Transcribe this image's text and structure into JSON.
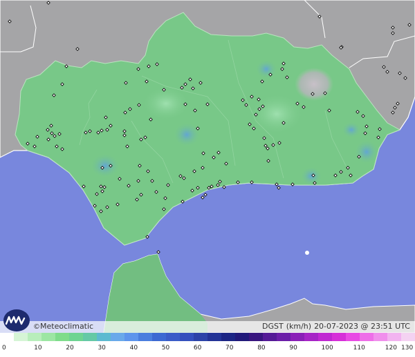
{
  "map": {
    "sea_color": "#7887dd",
    "land_outside_color": "#a5a5a7",
    "region_color": "#78c888",
    "marker_glyph": "⋄"
  },
  "brand": {
    "copyright_symbol": "©",
    "name": "Meteoclimatic",
    "logo_icon": "meteoclimatic-wave-logo"
  },
  "info": {
    "variable": "DGST",
    "unit": "(km/h)",
    "datetime": "20-07-2023 @ 23:51 UTC"
  },
  "legend": {
    "labels": [
      "0",
      "10",
      "20",
      "30",
      "40",
      "50",
      "60",
      "70",
      "80",
      "90",
      "100",
      "110",
      "120",
      "130"
    ],
    "colors": [
      "#ffffff",
      "#d6f5d6",
      "#b8eebb",
      "#9ce6a3",
      "#7fdc8b",
      "#6ed492",
      "#65c9a6",
      "#5dbad0",
      "#69a9ea",
      "#5d95ec",
      "#4a7ede",
      "#3c69d2",
      "#3a5cc8",
      "#3450bd",
      "#2c43a8",
      "#233396",
      "#1c2585",
      "#21197a",
      "#39157f",
      "#541a96",
      "#6b1ea8",
      "#8a1fb7",
      "#a624c6",
      "#c028d2",
      "#d630d8",
      "#e84ae4",
      "#ee6ee8",
      "#f08fec",
      "#f2b3f0",
      "#f4d2f2"
    ]
  }
}
